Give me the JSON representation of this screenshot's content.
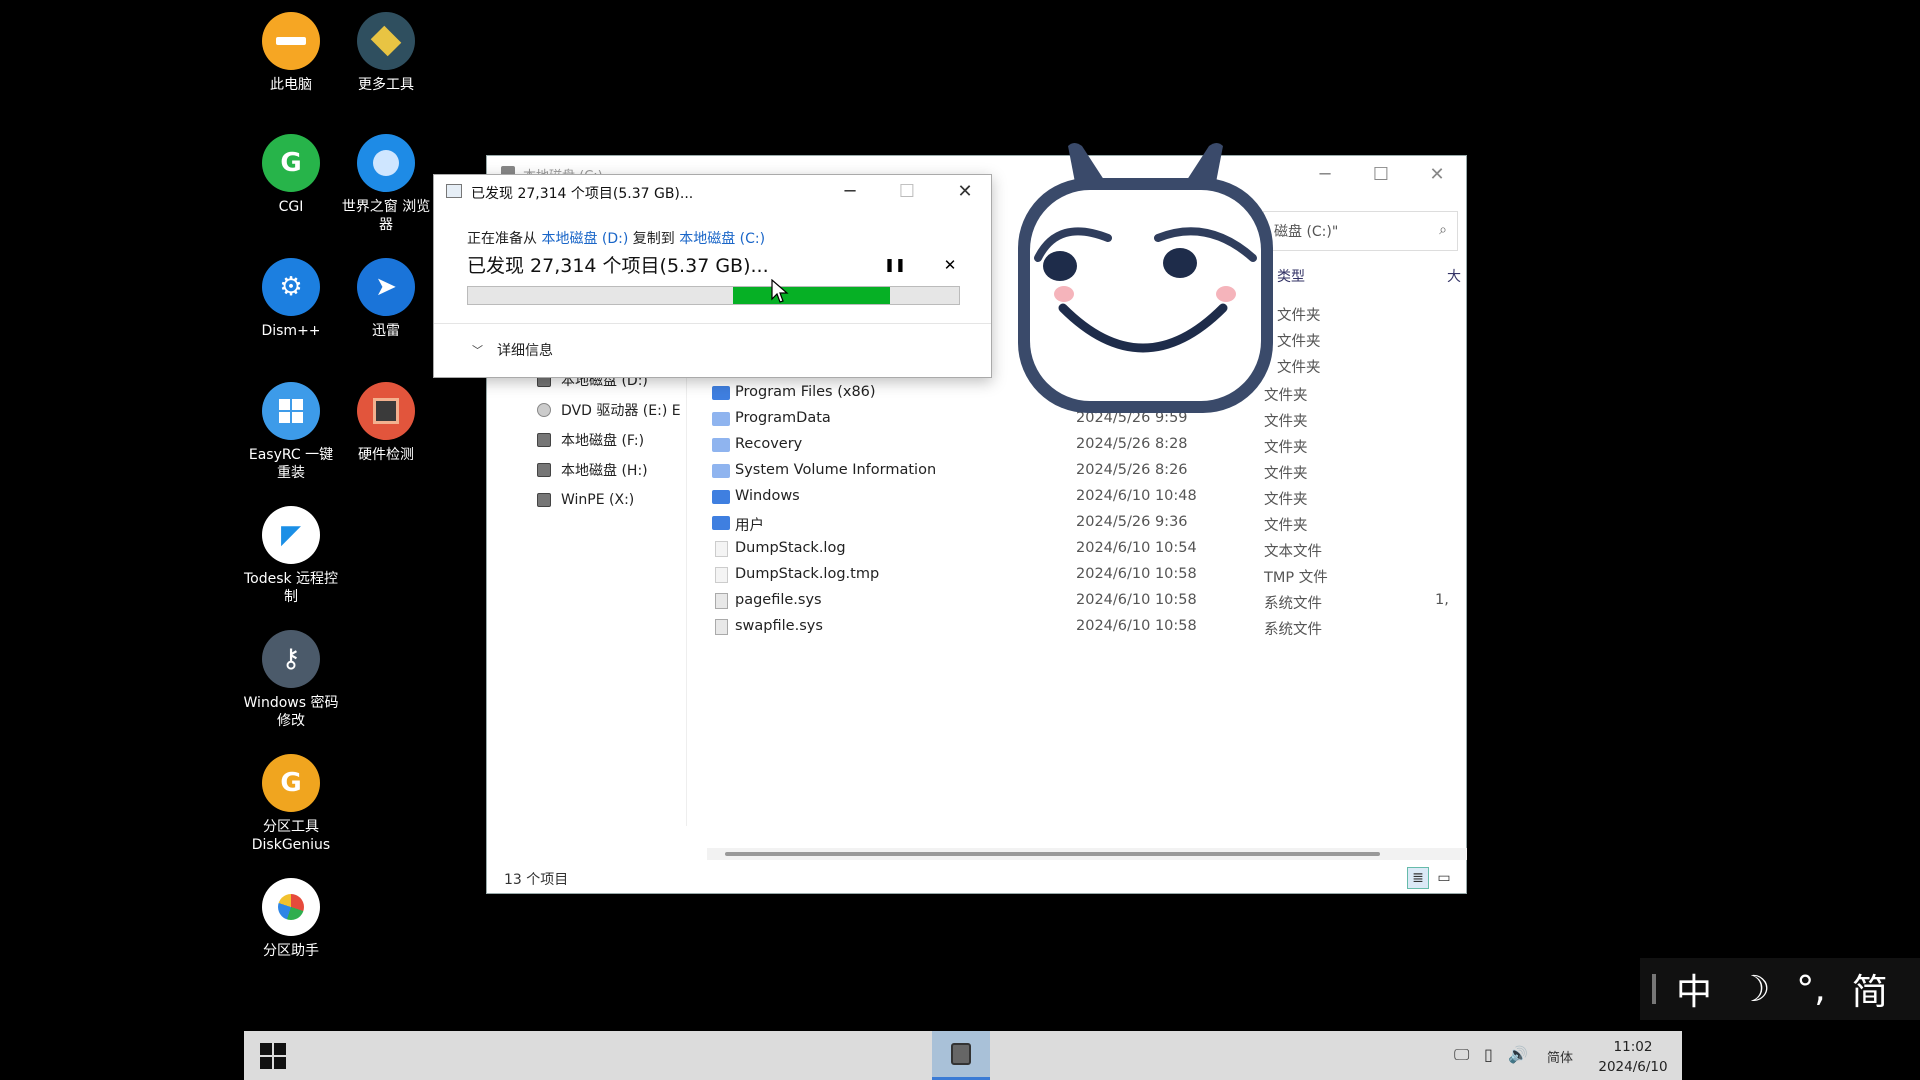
{
  "desktop": {
    "icons": [
      {
        "label": "此电脑"
      },
      {
        "label": "更多工具"
      },
      {
        "label": "CGI"
      },
      {
        "label": "世界之窗 浏览器"
      },
      {
        "label": "Dism++"
      },
      {
        "label": "迅雷"
      },
      {
        "label": "EasyRC 一键重装"
      },
      {
        "label": "硬件检测"
      },
      {
        "label": "Todesk 远程控制"
      },
      {
        "label": "Windows 密码修改"
      },
      {
        "label": "分区工具 DiskGenius"
      },
      {
        "label": "分区助手"
      }
    ]
  },
  "explorer": {
    "title": "本地磁盘 (C:)",
    "search_text": "磁盘 (C:)\"",
    "col_type": "类型",
    "col_size": "大",
    "nav": [
      {
        "label": "本地磁盘 (D:)"
      },
      {
        "label": "DVD 驱动器 (E:) E"
      },
      {
        "label": "本地磁盘 (F:)"
      },
      {
        "label": "本地磁盘 (H:)"
      },
      {
        "label": "WinPE (X:)"
      }
    ],
    "hidden_rows_types": [
      "文件夹",
      "文件夹",
      "文件夹"
    ],
    "files": [
      {
        "name": "Program Files (x86)",
        "date": "",
        "type": "文件夹",
        "size": ""
      },
      {
        "name": "ProgramData",
        "date": "2024/5/26 9:59",
        "type": "文件夹",
        "size": ""
      },
      {
        "name": "Recovery",
        "date": "2024/5/26 8:28",
        "type": "文件夹",
        "size": ""
      },
      {
        "name": "System Volume Information",
        "date": "2024/5/26 8:26",
        "type": "文件夹",
        "size": ""
      },
      {
        "name": "Windows",
        "date": "2024/6/10 10:48",
        "type": "文件夹",
        "size": ""
      },
      {
        "name": "用户",
        "date": "2024/5/26 9:36",
        "type": "文件夹",
        "size": ""
      },
      {
        "name": "DumpStack.log",
        "date": "2024/6/10 10:54",
        "type": "文本文件",
        "size": ""
      },
      {
        "name": "DumpStack.log.tmp",
        "date": "2024/6/10 10:58",
        "type": "TMP 文件",
        "size": ""
      },
      {
        "name": "pagefile.sys",
        "date": "2024/6/10 10:58",
        "type": "系统文件",
        "size": "1,"
      },
      {
        "name": "swapfile.sys",
        "date": "2024/6/10 10:58",
        "type": "系统文件",
        "size": ""
      }
    ],
    "status_count": "13 个项目"
  },
  "copy_dialog": {
    "title": "已发现 27,314 个项目(5.37 GB)...",
    "preparing_prefix": "正在准备从",
    "source": "本地磁盘 (D:)",
    "copy_to": "复制到",
    "destination": "本地磁盘 (C:)",
    "status_large": "已发现 27,314 个项目(5.37 GB)...",
    "progress_start": 0.54,
    "progress_end": 0.86,
    "details_label": "详细信息"
  },
  "ime": {
    "mode": "中",
    "moon": "☽",
    "punct": "°,",
    "script": "简"
  },
  "taskbar": {
    "ime_indicator": "简体",
    "time": "11:02",
    "date": "2024/6/10"
  },
  "colors": {
    "progress_green": "#06b025",
    "link_blue": "#1a66c8",
    "taskbar_bg": "#dcdcdc"
  }
}
